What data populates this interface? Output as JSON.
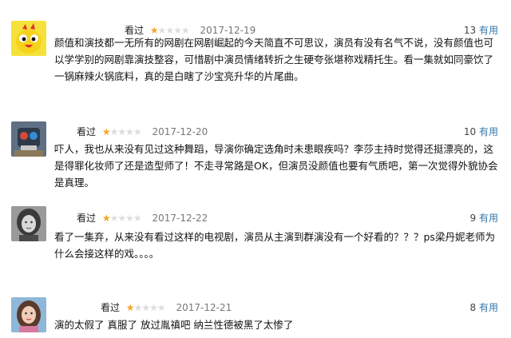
{
  "useful_label": "有用",
  "colors": {
    "star_filled": "#f5a623",
    "star_empty": "#dddddd",
    "useful_link": "#3377aa",
    "date": "#777777"
  },
  "reviews": [
    {
      "avatar": "yellow-cartoon-bird-avatar",
      "status": "看过",
      "rating": 1,
      "rating_max": 5,
      "date": "2017-12-19",
      "useful_count": "13",
      "content": "颜值和演技都一无所有的网剧在网剧崛起的今天简直不可思议，演员有没有名气不说，没有颜值也可以学学别的网剧靠演技整容，可惜剧中演员情绪转折之生硬夸张堪称戏精托生。看一集就如同豪饮了一锅麻辣火锅底料，真的是白瞎了沙宝亮升华的片尾曲。"
    },
    {
      "avatar": "robot-toy-avatar",
      "status": "看过",
      "rating": 1,
      "rating_max": 5,
      "date": "2017-12-20",
      "useful_count": "10",
      "content": "吓人，我也从来没有见过这种舞蹈，导演你确定选角时未患眼疾吗？李莎主持时觉得还挺漂亮的，这是得罪化妆师了还是造型师了！不走寻常路是OK，但演员没颜值也要有气质吧，第一次觉得外貌协会是真理。"
    },
    {
      "avatar": "woman-portrait-bw-avatar",
      "status": "看过",
      "rating": 1,
      "rating_max": 5,
      "date": "2017-12-22",
      "useful_count": "9",
      "content": "看了一集弃，从来没有看过这样的电视剧，演员从主演到群演没有一个好看的？？？ps梁丹妮老师为什么会接这样的戏。。。。"
    },
    {
      "avatar": "woman-portrait-color-avatar",
      "status": "看过",
      "rating": 1,
      "rating_max": 5,
      "date": "2017-12-21",
      "useful_count": "8",
      "content": "演的太假了 真服了 放过胤禛吧 纳兰性德被黑了太惨了"
    }
  ]
}
